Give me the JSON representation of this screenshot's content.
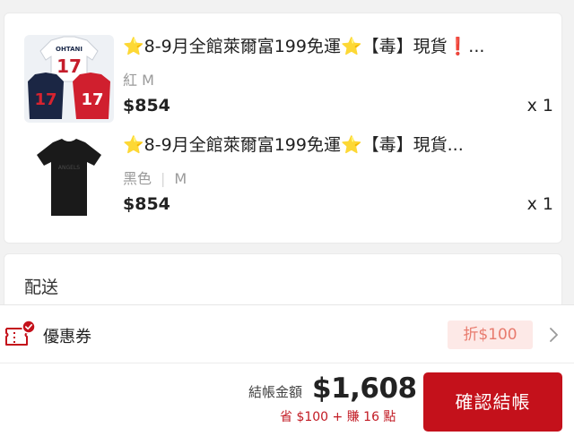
{
  "items": [
    {
      "title_star": "⭐",
      "title": "8-9月全館萊爾富199免運⭐【毒】現貨❗...",
      "variant_color": "紅",
      "variant_size": "M",
      "price": "$854",
      "qty": "x 1",
      "image_icon": "jersey-set-image",
      "jersey_name": "OHTANI",
      "jersey_number": "17"
    },
    {
      "title_star": "⭐",
      "title": "8-9月全館萊爾富199免運⭐【毒】現貨...",
      "variant_color": "黑色",
      "variant_sep": "|",
      "variant_size": "M",
      "price": "$854",
      "qty": "x 1",
      "image_icon": "black-tshirt-image",
      "shirt_text": "ANGELS"
    }
  ],
  "shipping": {
    "label": "配送"
  },
  "coupon": {
    "label": "優惠券",
    "tag": "折$100",
    "icon": "ticket-icon"
  },
  "footer": {
    "total_label": "結帳金額",
    "total_value": "$1,608",
    "savings": "省 $100 + 賺 16 點",
    "confirm_label": "確認結帳"
  },
  "colors": {
    "brand": "#c4111b",
    "coupon_tag_bg": "#fde9e7",
    "coupon_tag_text": "#e87b6e",
    "star": "#f3b51d"
  }
}
